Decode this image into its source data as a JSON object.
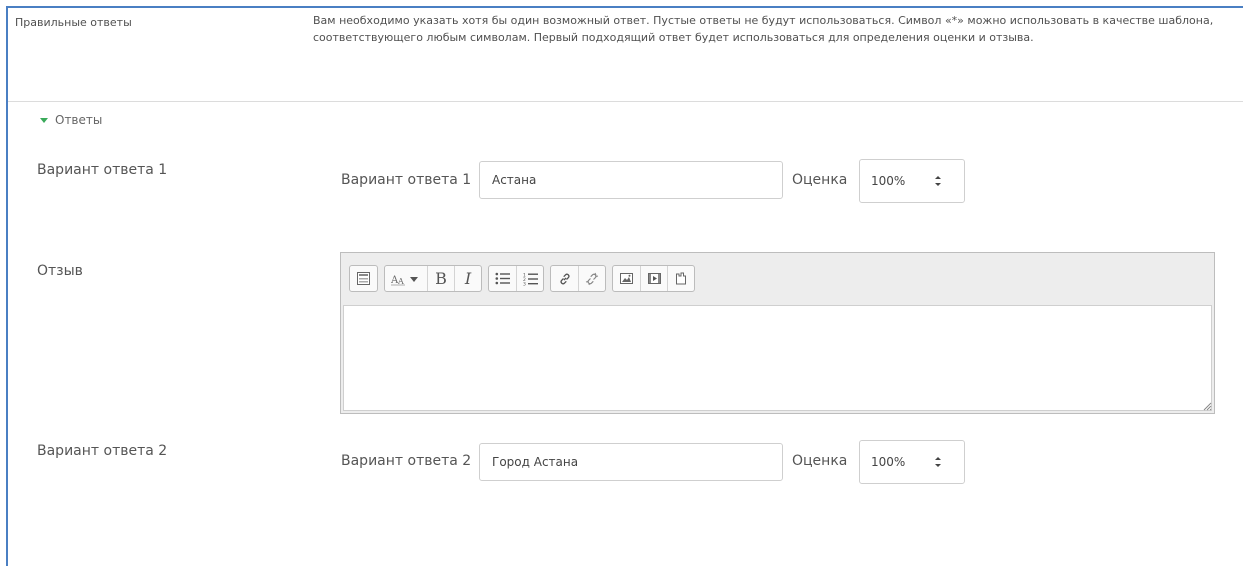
{
  "correct_answers": {
    "label": "Правильные ответы",
    "help": "Вам необходимо указать хотя бы один возможный ответ. Пустые ответы не будут использоваться. Символ «*» можно использовать в качестве шаблона, соответствующего любым символам. Первый подходящий ответ будет использоваться для определения оценки и отзыва."
  },
  "answers_section": {
    "label": "Ответы",
    "expanded": true
  },
  "answer1": {
    "row_label": "Вариант ответа 1",
    "inline_label": "Вариант ответа 1",
    "value": "Астана",
    "grade_label": "Оценка",
    "grade_value": "100%"
  },
  "feedback": {
    "label": "Отзыв",
    "toolbar_icons": [
      "toolbar-toggle-icon",
      "font-style-icon",
      "bold-icon",
      "italic-icon",
      "bullet-list-icon",
      "numbered-list-icon",
      "link-icon",
      "unlink-icon",
      "image-icon",
      "media-icon",
      "manage-files-icon"
    ],
    "bold_glyph": "B",
    "italic_glyph": "I",
    "content": ""
  },
  "answer2": {
    "row_label": "Вариант ответа 2",
    "inline_label": "Вариант ответа 2",
    "value": "Город Астана",
    "grade_label": "Оценка",
    "grade_value": "100%"
  },
  "colors": {
    "frame": "#4a7fc3",
    "toggle": "#3aaa5a"
  }
}
